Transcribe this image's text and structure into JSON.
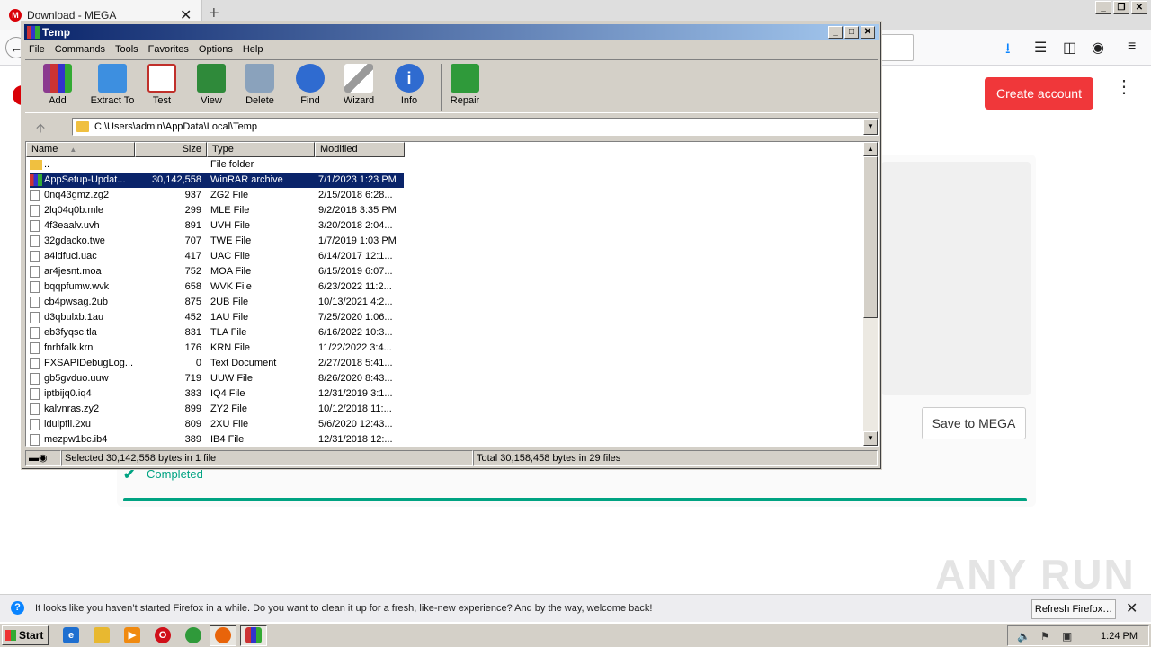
{
  "browser": {
    "tab_title": "Download - MEGA",
    "tab_close": "✕",
    "new_tab": "+"
  },
  "mega": {
    "create_account": "Create account",
    "save_to_mega": "Save to MEGA",
    "completed": "Completed",
    "progress": 1.0,
    "accent": "#00a382",
    "brand": "#d90007"
  },
  "watermark": "ANY RUN",
  "notification": {
    "text": "It looks like you haven’t started Firefox in a while. Do you want to clean it up for a fresh, like-new experience? And by the way, welcome back!",
    "refresh_button": "Refresh Firefox…"
  },
  "taskbar": {
    "start": "Start",
    "clock": "1:24 PM"
  },
  "winrar": {
    "title": "Temp",
    "menu": [
      "File",
      "Commands",
      "Tools",
      "Favorites",
      "Options",
      "Help"
    ],
    "tools": [
      {
        "label": "Add",
        "icon": "add-archive-icon",
        "color": "#8b3a8f"
      },
      {
        "label": "Extract To",
        "icon": "extract-folder-icon",
        "color": "#3d8fe0"
      },
      {
        "label": "Test",
        "icon": "test-clipboard-icon",
        "color": "#c0302a"
      },
      {
        "label": "View",
        "icon": "view-book-icon",
        "color": "#2f8a3a"
      },
      {
        "label": "Delete",
        "icon": "trash-icon",
        "color": "#6f8aa8"
      },
      {
        "label": "Find",
        "icon": "magnifier-icon",
        "color": "#2f6bd0"
      },
      {
        "label": "Wizard",
        "icon": "magic-wand-icon",
        "color": "#9a9a9a"
      },
      {
        "label": "Info",
        "icon": "info-icon",
        "color": "#2f6bd0"
      },
      {
        "label": "Repair",
        "icon": "repair-kit-icon",
        "color": "#2f9a3a"
      }
    ],
    "path": "C:\\Users\\admin\\AppData\\Local\\Temp",
    "columns": {
      "name": "Name",
      "size": "Size",
      "type": "Type",
      "modified": "Modified"
    },
    "files": [
      {
        "name": "..",
        "size": "",
        "type": "File folder",
        "modified": "",
        "kind": "folder"
      },
      {
        "name": "AppSetup-Updat...",
        "size": "30,142,558",
        "type": "WinRAR archive",
        "modified": "7/1/2023 1:23 PM",
        "kind": "rar",
        "selected": true
      },
      {
        "name": "0nq43gmz.zg2",
        "size": "937",
        "type": "ZG2 File",
        "modified": "2/15/2018 6:28...",
        "kind": "file"
      },
      {
        "name": "2lq04q0b.mle",
        "size": "299",
        "type": "MLE File",
        "modified": "9/2/2018 3:35 PM",
        "kind": "file"
      },
      {
        "name": "4f3eaalv.uvh",
        "size": "891",
        "type": "UVH File",
        "modified": "3/20/2018 2:04...",
        "kind": "file"
      },
      {
        "name": "32gdacko.twe",
        "size": "707",
        "type": "TWE File",
        "modified": "1/7/2019 1:03 PM",
        "kind": "file"
      },
      {
        "name": "a4ldfuci.uac",
        "size": "417",
        "type": "UAC File",
        "modified": "6/14/2017 12:1...",
        "kind": "file"
      },
      {
        "name": "ar4jesnt.moa",
        "size": "752",
        "type": "MOA File",
        "modified": "6/15/2019 6:07...",
        "kind": "file"
      },
      {
        "name": "bqqpfumw.wvk",
        "size": "658",
        "type": "WVK File",
        "modified": "6/23/2022 11:2...",
        "kind": "file"
      },
      {
        "name": "cb4pwsag.2ub",
        "size": "875",
        "type": "2UB File",
        "modified": "10/13/2021 4:2...",
        "kind": "file"
      },
      {
        "name": "d3qbulxb.1au",
        "size": "452",
        "type": "1AU File",
        "modified": "7/25/2020 1:06...",
        "kind": "file"
      },
      {
        "name": "eb3fyqsc.tla",
        "size": "831",
        "type": "TLA File",
        "modified": "6/16/2022 10:3...",
        "kind": "file"
      },
      {
        "name": "fnrhfalk.krn",
        "size": "176",
        "type": "KRN File",
        "modified": "11/22/2022 3:4...",
        "kind": "file"
      },
      {
        "name": "FXSAPIDebugLog...",
        "size": "0",
        "type": "Text Document",
        "modified": "2/27/2018 5:41...",
        "kind": "file"
      },
      {
        "name": "gb5gvduo.uuw",
        "size": "719",
        "type": "UUW File",
        "modified": "8/26/2020 8:43...",
        "kind": "file"
      },
      {
        "name": "iptbijq0.iq4",
        "size": "383",
        "type": "IQ4 File",
        "modified": "12/31/2019 3:1...",
        "kind": "file"
      },
      {
        "name": "kalvnras.zy2",
        "size": "899",
        "type": "ZY2 File",
        "modified": "10/12/2018 11:...",
        "kind": "file"
      },
      {
        "name": "ldulpfli.2xu",
        "size": "809",
        "type": "2XU File",
        "modified": "5/6/2020 12:43...",
        "kind": "file"
      },
      {
        "name": "mezpw1bc.ib4",
        "size": "389",
        "type": "IB4 File",
        "modified": "12/31/2018 12:...",
        "kind": "file"
      }
    ],
    "status_selected": "Selected 30,142,558 bytes in 1 file",
    "status_total": "Total 30,158,458 bytes in 29 files"
  }
}
